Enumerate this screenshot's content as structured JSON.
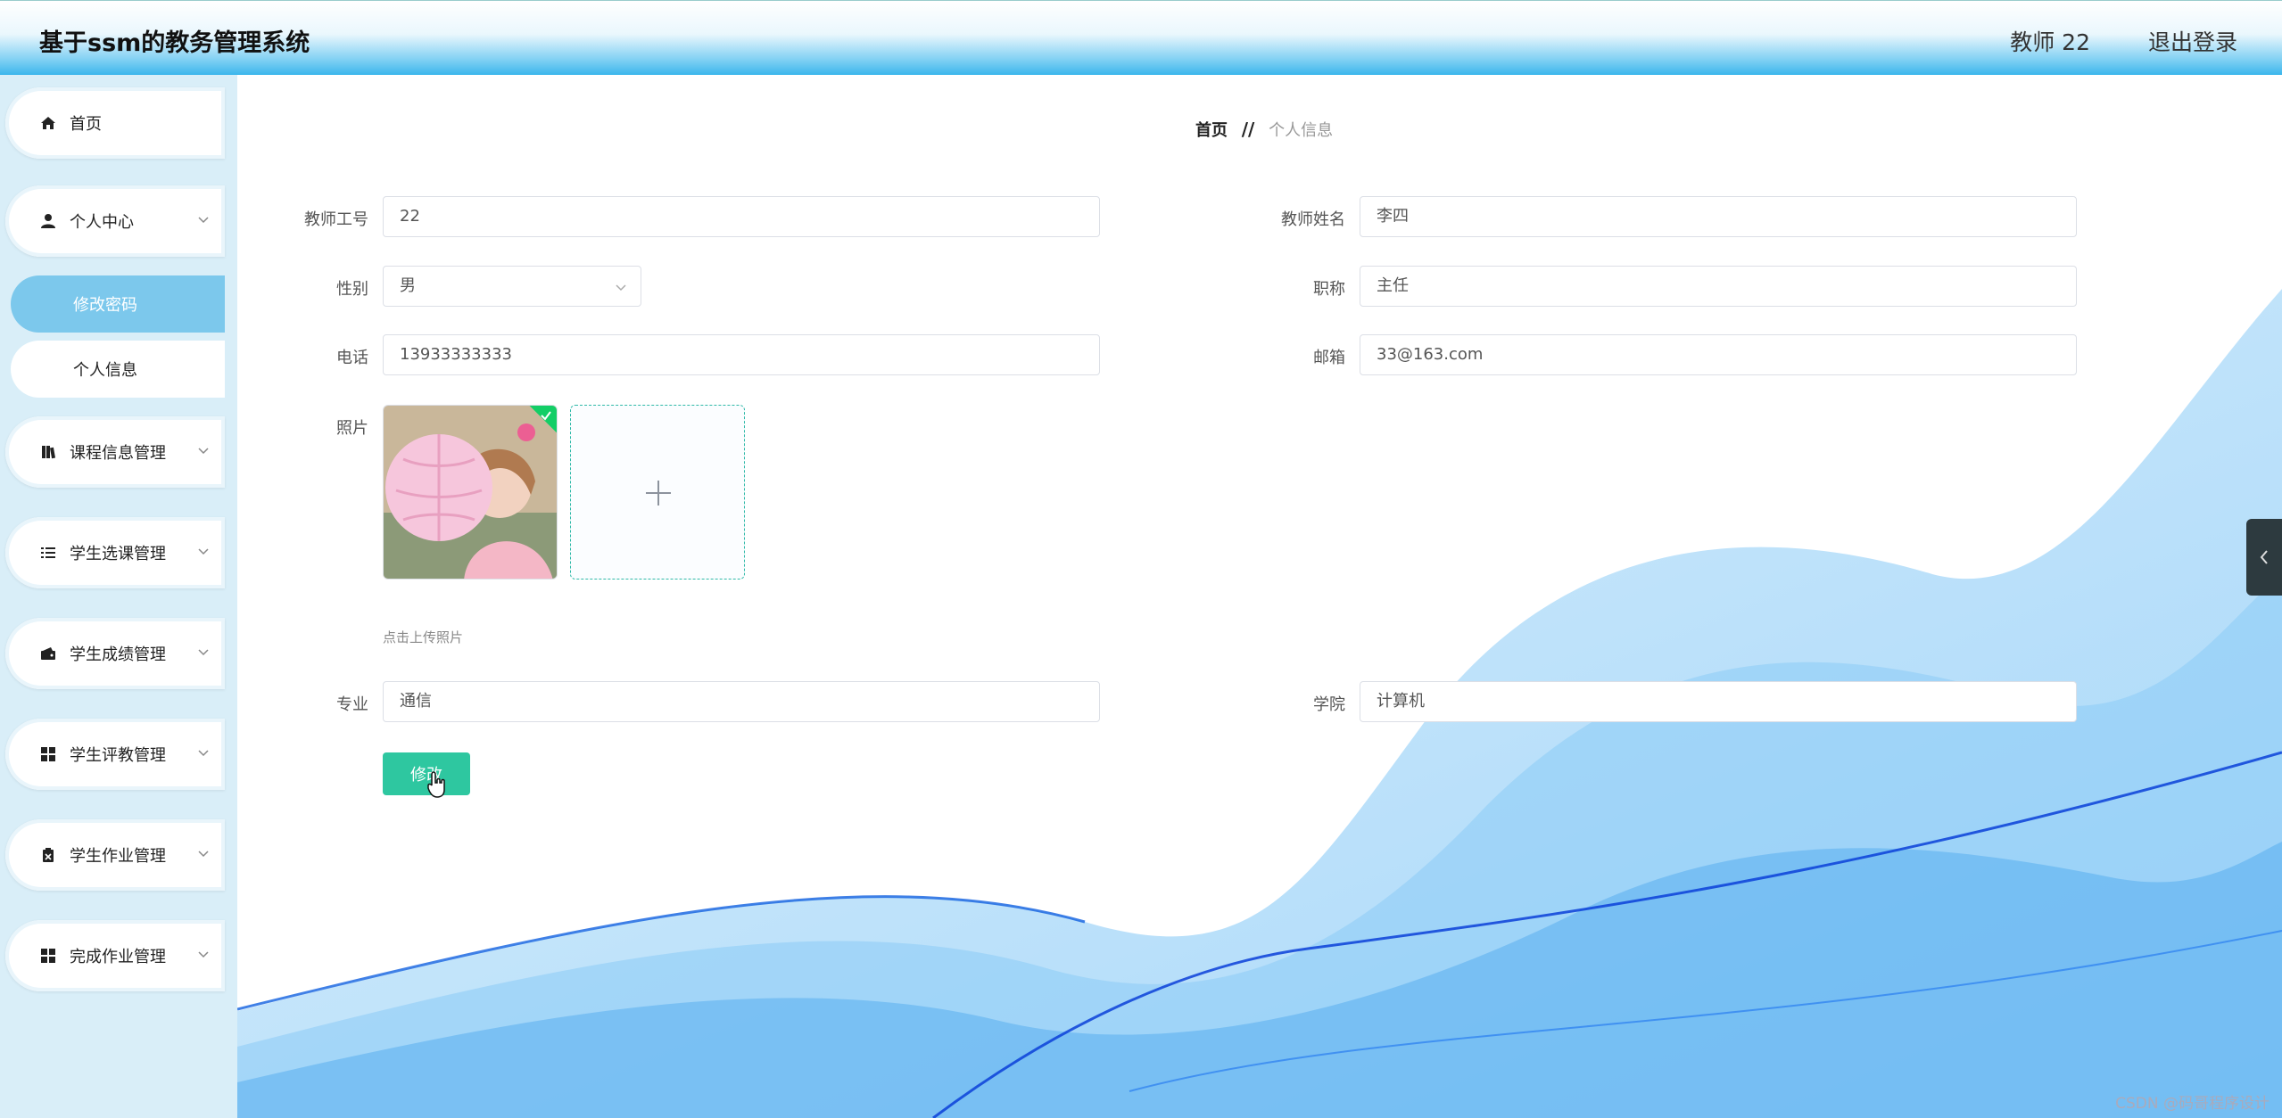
{
  "header": {
    "app_title": "基于ssm的教务管理系统",
    "user": "教师 22",
    "logout": "退出登录"
  },
  "sidebar": {
    "home": "首页",
    "personal_center": "个人中心",
    "sub_change_password": "修改密码",
    "sub_personal_info": "个人信息",
    "course_mgmt": "课程信息管理",
    "course_selection_mgmt": "学生选课管理",
    "grades_mgmt": "学生成绩管理",
    "evaluation_mgmt": "学生评教管理",
    "homework_mgmt": "学生作业管理",
    "completed_homework_mgmt": "完成作业管理"
  },
  "breadcrumb": {
    "home": "首页",
    "separator": "//",
    "current": "个人信息"
  },
  "form": {
    "teacher_id_label": "教师工号",
    "teacher_id": "22",
    "teacher_name_label": "教师姓名",
    "teacher_name": "李四",
    "gender_label": "性别",
    "gender": "男",
    "title_label": "职称",
    "title": "主任",
    "phone_label": "电话",
    "phone": "13933333333",
    "email_label": "邮箱",
    "email": "33@163.com",
    "photo_label": "照片",
    "upload_hint": "点击上传照片",
    "major_label": "专业",
    "major": "通信",
    "college_label": "学院",
    "college": "计算机",
    "submit": "修改"
  },
  "watermark": "CSDN @码哥程序设计",
  "colors": {
    "accent": "#2ec7a0",
    "sidebar_bg": "#d9eef8",
    "active_item": "#7cc8ec",
    "header": "#3bb6ec"
  }
}
